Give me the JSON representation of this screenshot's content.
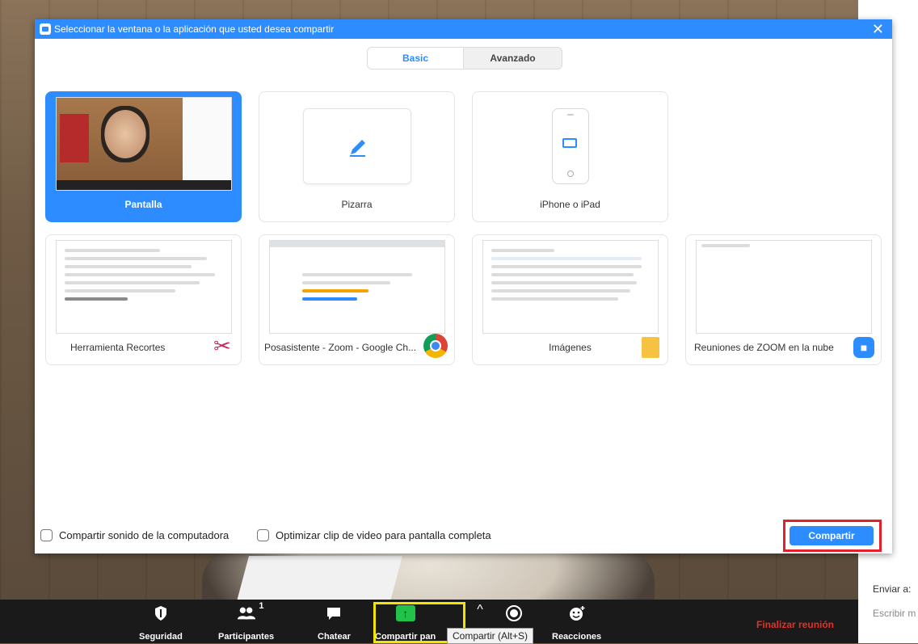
{
  "dialog": {
    "title": "Seleccionar la ventana o la aplicación que usted desea compartir",
    "close": "✕",
    "tabs": {
      "basic": "Basic",
      "advanced": "Avanzado"
    },
    "tiles": [
      {
        "label": "Pantalla",
        "selected": true
      },
      {
        "label": "Pizarra"
      },
      {
        "label": "iPhone o iPad"
      },
      {
        "label": "Herramienta Recortes"
      },
      {
        "label": "Posasistente - Zoom - Google Ch..."
      },
      {
        "label": "Imágenes"
      },
      {
        "label": "Reuniones de ZOOM en la nube"
      }
    ],
    "options": {
      "share_sound": "Compartir sonido de la computadora",
      "optimize_video": "Optimizar clip de video para pantalla completa"
    },
    "share_button": "Compartir"
  },
  "toolbar": {
    "security": "Seguridad",
    "participants": "Participantes",
    "participant_count": "1",
    "chat": "Chatear",
    "share": "Compartir pan",
    "tooltip": "Compartir (Alt+S)",
    "reactions": "Reacciones",
    "end": "Finalizar reunión"
  },
  "right_panel": {
    "send_to": "Enviar a:",
    "write": "Escribir m"
  },
  "colors": {
    "accent": "#2d8cff",
    "highlight_red": "#e0202a",
    "highlight_yellow": "#f2e600",
    "end_red": "#e0322c"
  }
}
